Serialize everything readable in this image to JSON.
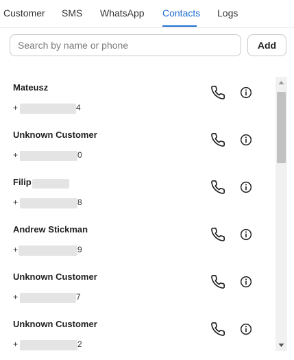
{
  "tabs": [
    {
      "label": "Customer",
      "active": false
    },
    {
      "label": "SMS",
      "active": false
    },
    {
      "label": "WhatsApp",
      "active": false
    },
    {
      "label": "Contacts",
      "active": true
    },
    {
      "label": "Logs",
      "active": false
    }
  ],
  "search": {
    "placeholder": "Search by name or phone",
    "value": ""
  },
  "add_button": {
    "label": "Add"
  },
  "contacts": [
    {
      "name": "Mateusz",
      "phone_start": "+",
      "phone_end": "4"
    },
    {
      "name": "Unknown Customer",
      "phone_start": "+",
      "phone_end": "0"
    },
    {
      "name": "Filip",
      "phone_start": "+",
      "phone_end": "8"
    },
    {
      "name": "Andrew Stickman",
      "phone_start": "+",
      "phone_end": "9"
    },
    {
      "name": "Unknown Customer",
      "phone_start": "+",
      "phone_end": "7"
    },
    {
      "name": "Unknown Customer",
      "phone_start": "+",
      "phone_end": "2"
    }
  ],
  "icons": {
    "call": "phone-icon",
    "info": "info-icon",
    "scroll_up": "triangle-up-icon",
    "scroll_down": "triangle-down-icon"
  },
  "colors": {
    "accent": "#1f6fd1",
    "border": "#c8c8c8",
    "redaction": "#e4e4e4",
    "scroll_thumb": "#c1c1c1"
  }
}
